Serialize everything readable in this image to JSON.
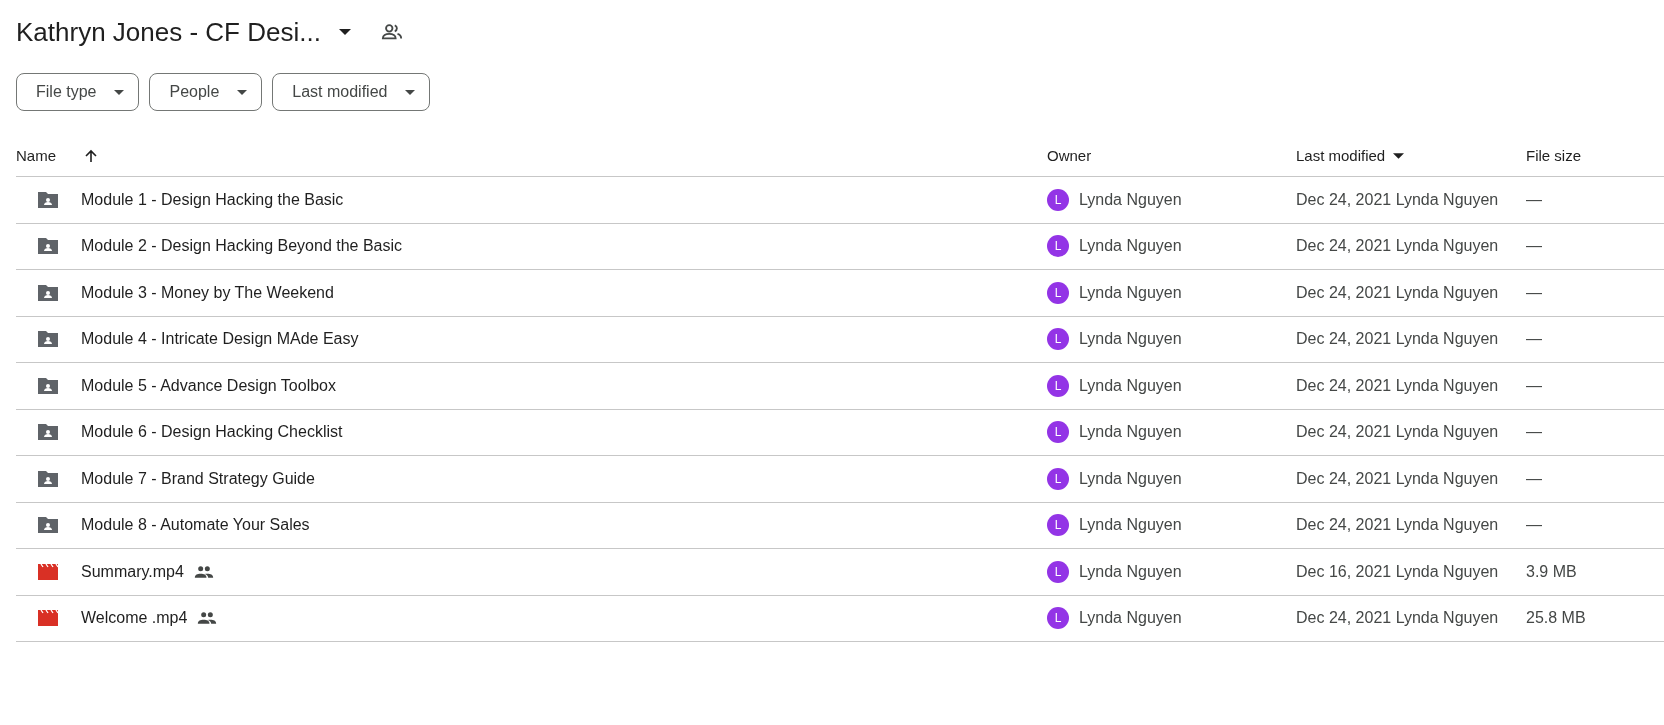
{
  "title": "Kathryn Jones - CF Desi...",
  "filters": [
    "File type",
    "People",
    "Last modified"
  ],
  "columns": {
    "name": "Name",
    "owner": "Owner",
    "modified": "Last modified",
    "size": "File size"
  },
  "rows": [
    {
      "kind": "folder",
      "name": "Module 1 - Design Hacking the Basic",
      "shared": false,
      "avatar": "L",
      "owner": "Lynda Nguyen",
      "modified": "Dec 24, 2021 Lynda Nguyen",
      "size": "—"
    },
    {
      "kind": "folder",
      "name": "Module 2 - Design Hacking Beyond the Basic",
      "shared": false,
      "avatar": "L",
      "owner": "Lynda Nguyen",
      "modified": "Dec 24, 2021 Lynda Nguyen",
      "size": "—"
    },
    {
      "kind": "folder",
      "name": "Module 3 - Money by The Weekend",
      "shared": false,
      "avatar": "L",
      "owner": "Lynda Nguyen",
      "modified": "Dec 24, 2021 Lynda Nguyen",
      "size": "—"
    },
    {
      "kind": "folder",
      "name": "Module 4 - Intricate Design MAde Easy",
      "shared": false,
      "avatar": "L",
      "owner": "Lynda Nguyen",
      "modified": "Dec 24, 2021 Lynda Nguyen",
      "size": "—"
    },
    {
      "kind": "folder",
      "name": "Module 5 - Advance Design Toolbox",
      "shared": false,
      "avatar": "L",
      "owner": "Lynda Nguyen",
      "modified": "Dec 24, 2021 Lynda Nguyen",
      "size": "—"
    },
    {
      "kind": "folder",
      "name": "Module 6 - Design Hacking Checklist",
      "shared": false,
      "avatar": "L",
      "owner": "Lynda Nguyen",
      "modified": "Dec 24, 2021 Lynda Nguyen",
      "size": "—"
    },
    {
      "kind": "folder",
      "name": "Module 7 - Brand Strategy Guide",
      "shared": false,
      "avatar": "L",
      "owner": "Lynda Nguyen",
      "modified": "Dec 24, 2021 Lynda Nguyen",
      "size": "—"
    },
    {
      "kind": "folder",
      "name": "Module 8 - Automate Your Sales",
      "shared": false,
      "avatar": "L",
      "owner": "Lynda Nguyen",
      "modified": "Dec 24, 2021 Lynda Nguyen",
      "size": "—"
    },
    {
      "kind": "video",
      "name": "Summary.mp4",
      "shared": true,
      "avatar": "L",
      "owner": "Lynda Nguyen",
      "modified": "Dec 16, 2021 Lynda Nguyen",
      "size": "3.9 MB"
    },
    {
      "kind": "video",
      "name": "Welcome .mp4",
      "shared": true,
      "avatar": "L",
      "owner": "Lynda Nguyen",
      "modified": "Dec 24, 2021 Lynda Nguyen",
      "size": "25.8 MB"
    }
  ]
}
